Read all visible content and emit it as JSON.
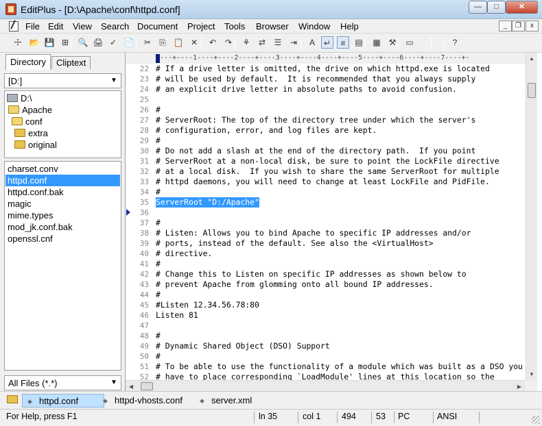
{
  "window": {
    "title": "EditPlus - [D:\\Apache\\conf\\httpd.conf]"
  },
  "caption_buttons": {
    "minimize": "—",
    "maximize": "□",
    "close": "✕"
  },
  "menu": [
    "File",
    "Edit",
    "View",
    "Search",
    "Document",
    "Project",
    "Tools",
    "Browser",
    "Window",
    "Help"
  ],
  "mdi_buttons": {
    "minimize": "_",
    "restore": "❐",
    "close": "x"
  },
  "toolbar": {
    "icons": [
      "new-icon",
      "open-icon",
      "save-icon",
      "save-all-icon",
      "print-preview-icon",
      "print-icon",
      "spell-check-icon",
      "notes-icon",
      "cut-icon",
      "copy-icon",
      "paste-icon",
      "delete-icon",
      "undo-icon",
      "redo-icon",
      "find-icon",
      "replace-icon",
      "find-in-files-icon",
      "goto-icon",
      "font-icon",
      "word-wrap-icon",
      "line-number-icon",
      "ruler-icon",
      "column-select-icon",
      "editor-settings-icon",
      "browser-icon",
      "help-icon"
    ],
    "glyphs": [
      "☩",
      "📂",
      "💾",
      "⊞",
      "🔍",
      "🖨",
      "✓",
      "📄",
      "✂",
      "⎘",
      "📋",
      "✕",
      "↶",
      "↷",
      "⚘",
      "⇄",
      "☰",
      "⇥",
      "A",
      "↵",
      "≡",
      "▤",
      "▦",
      "⚒",
      "▭",
      "?"
    ]
  },
  "left_panel": {
    "tabs": [
      "Directory",
      "Cliptext"
    ],
    "drive": "[D:]",
    "tree": [
      {
        "label": "D:\\",
        "type": "drive"
      },
      {
        "label": "Apache",
        "type": "folder-open"
      },
      {
        "label": "conf",
        "type": "folder-open"
      },
      {
        "label": "extra",
        "type": "folder"
      },
      {
        "label": "original",
        "type": "folder"
      }
    ],
    "files": [
      "charset.conv",
      "httpd.conf",
      "httpd.conf.bak",
      "magic",
      "mime.types",
      "mod_jk.conf.bak",
      "openssl.cnf"
    ],
    "selected_file": "httpd.conf",
    "filter": "All Files (*.*)"
  },
  "editor": {
    "ruler": "----+----1----+----2----+----3----+----4----+----5----+----6----+----7----+-",
    "lines": [
      {
        "n": "22",
        "text": "# If a drive letter is omitted, the drive on which httpd.exe is located"
      },
      {
        "n": "23",
        "text": "# will be used by default.  It is recommended that you always supply"
      },
      {
        "n": "24",
        "text": "# an explicit drive letter in absolute paths to avoid confusion."
      },
      {
        "n": "25",
        "text": ""
      },
      {
        "n": "26",
        "text": "#"
      },
      {
        "n": "27",
        "text": "# ServerRoot: The top of the directory tree under which the server's"
      },
      {
        "n": "28",
        "text": "# configuration, error, and log files are kept."
      },
      {
        "n": "29",
        "text": "#"
      },
      {
        "n": "30",
        "text": "# Do not add a slash at the end of the directory path.  If you point"
      },
      {
        "n": "31",
        "text": "# ServerRoot at a non-local disk, be sure to point the LockFile directive"
      },
      {
        "n": "32",
        "text": "# at a local disk.  If you wish to share the same ServerRoot for multiple"
      },
      {
        "n": "33",
        "text": "# httpd daemons, you will need to change at least LockFile and PidFile."
      },
      {
        "n": "34",
        "text": "#"
      },
      {
        "n": "35",
        "text": "ServerRoot \"D:/Apache\""
      },
      {
        "n": "36",
        "text": ""
      },
      {
        "n": "37",
        "text": "#"
      },
      {
        "n": "38",
        "text": "# Listen: Allows you to bind Apache to specific IP addresses and/or"
      },
      {
        "n": "39",
        "text": "# ports, instead of the default. See also the <VirtualHost>"
      },
      {
        "n": "40",
        "text": "# directive."
      },
      {
        "n": "41",
        "text": "#"
      },
      {
        "n": "42",
        "text": "# Change this to Listen on specific IP addresses as shown below to"
      },
      {
        "n": "43",
        "text": "# prevent Apache from glomming onto all bound IP addresses."
      },
      {
        "n": "44",
        "text": "#"
      },
      {
        "n": "45",
        "text": "#Listen 12.34.56.78:80"
      },
      {
        "n": "46",
        "text": "Listen 81"
      },
      {
        "n": "47",
        "text": ""
      },
      {
        "n": "48",
        "text": "#"
      },
      {
        "n": "49",
        "text": "# Dynamic Shared Object (DSO) Support"
      },
      {
        "n": "50",
        "text": "#"
      },
      {
        "n": "51",
        "text": "# To be able to use the functionality of a module which was built as a DSO you"
      },
      {
        "n": "52",
        "text": "# have to place corresponding `LoadModule' lines at this location so the"
      }
    ],
    "highlighted_line": "35",
    "scroll": {
      "up": "▲",
      "down": "▼",
      "left": "◀",
      "right": "▶"
    }
  },
  "doc_tabs": [
    {
      "label": "httpd.conf",
      "active": true
    },
    {
      "label": "httpd-vhosts.conf",
      "active": false
    },
    {
      "label": "server.xml",
      "active": false
    }
  ],
  "doc_tab_glyph": "◈",
  "status": {
    "help": "For Help, press F1",
    "line": "ln 35",
    "col": "col 1",
    "total_lines": "494",
    "field4": "53",
    "format": "PC",
    "encoding": "ANSI"
  }
}
